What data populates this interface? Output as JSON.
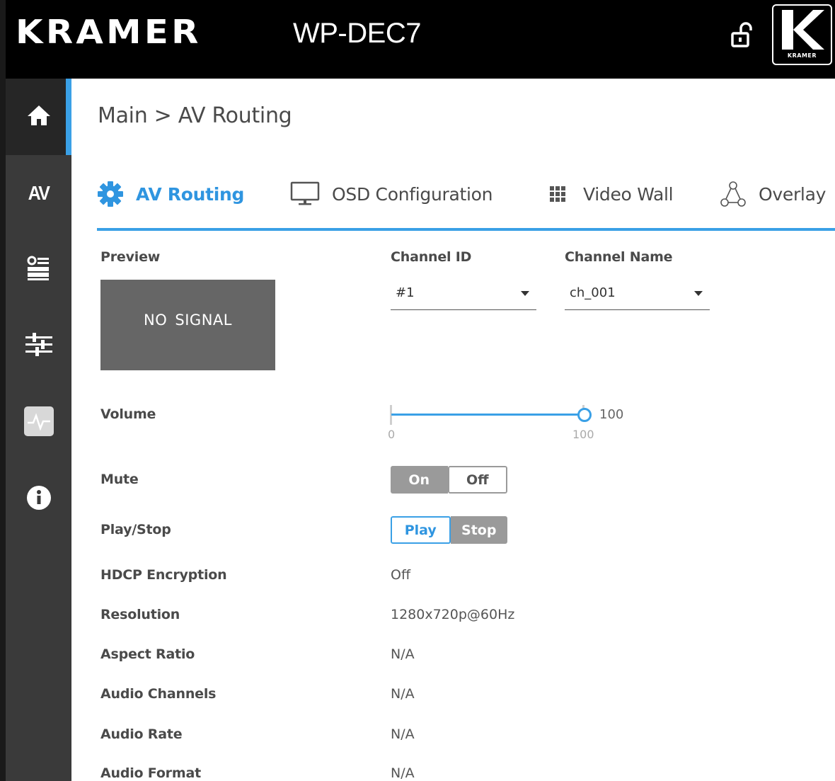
{
  "header": {
    "brand": "KRAMER",
    "model": "WP-DEC7",
    "logo_text": "KRAMER"
  },
  "sidebar": {
    "items": [
      {
        "icon": "home-icon",
        "label": ""
      },
      {
        "icon": "av-icon",
        "label": "AV"
      },
      {
        "icon": "device-settings-icon",
        "label": ""
      },
      {
        "icon": "sliders-icon",
        "label": ""
      },
      {
        "icon": "diagnostics-icon",
        "label": ""
      },
      {
        "icon": "info-icon",
        "label": ""
      }
    ],
    "active_index": 0
  },
  "breadcrumb": "Main > AV Routing",
  "tabs": [
    {
      "label": "AV Routing",
      "icon": "gear-icon",
      "active": true
    },
    {
      "label": "OSD Configuration",
      "icon": "monitor-icon",
      "active": false
    },
    {
      "label": "Video Wall",
      "icon": "grid-icon",
      "active": false
    },
    {
      "label": "Overlay",
      "icon": "overlay-icon",
      "active": false
    }
  ],
  "preview": {
    "label": "Preview",
    "text": "NO SIGNAL"
  },
  "channel_id": {
    "label": "Channel ID",
    "value": "#1"
  },
  "channel_name": {
    "label": "Channel Name",
    "value": "ch_001"
  },
  "volume": {
    "label": "Volume",
    "min": "0",
    "max": "100",
    "value": "100"
  },
  "mute": {
    "label": "Mute",
    "on_label": "On",
    "off_label": "Off",
    "selected": "Off"
  },
  "play_stop": {
    "label": "Play/Stop",
    "play_label": "Play",
    "stop_label": "Stop",
    "selected": "Play"
  },
  "info_rows": [
    {
      "label": "HDCP Encryption",
      "value": "Off"
    },
    {
      "label": "Resolution",
      "value": "1280x720p@60Hz"
    },
    {
      "label": "Aspect Ratio",
      "value": "N/A"
    },
    {
      "label": "Audio Channels",
      "value": "N/A"
    },
    {
      "label": "Audio Rate",
      "value": "N/A"
    },
    {
      "label": "Audio Format",
      "value": "N/A"
    }
  ],
  "colors": {
    "accent": "#3aa0e6",
    "header_bg": "#000000",
    "sidebar_bg": "#3a3a3a",
    "preview_bg": "#666666"
  }
}
